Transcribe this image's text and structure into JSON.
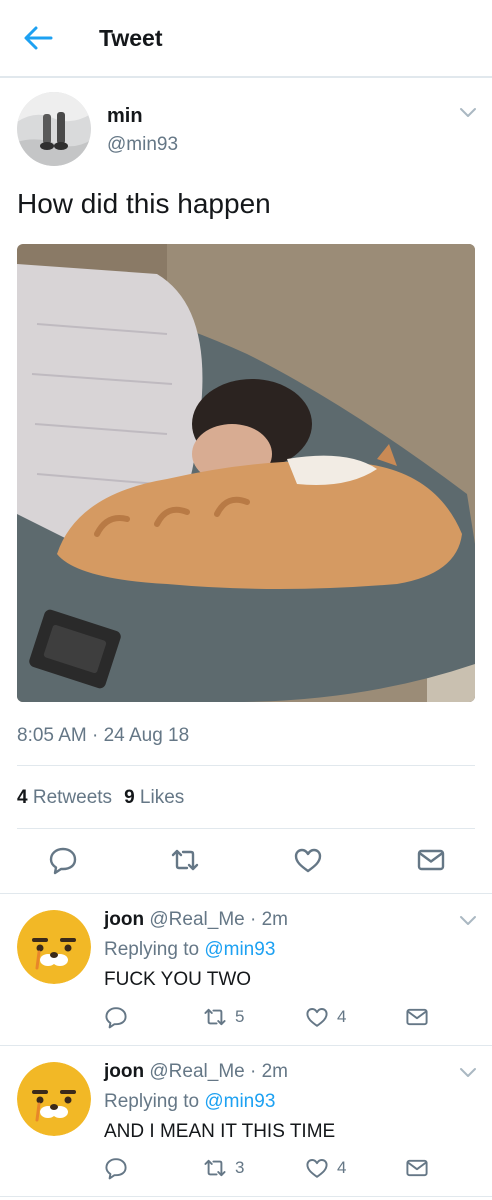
{
  "header": {
    "title": "Tweet"
  },
  "tweet": {
    "author_name": "min",
    "author_handle": "@min93",
    "text": "How did this happen",
    "timestamp": "8:05 AM · 24 Aug 18",
    "retweets_count": "4",
    "retweets_label": "Retweets",
    "likes_count": "9",
    "likes_label": "Likes"
  },
  "replies": [
    {
      "name": "joon",
      "handle": "@Real_Me",
      "time": "· 2m",
      "replying_prefix": "Replying to",
      "replying_handle": "@min93",
      "text": "FUCK YOU TWO",
      "retweets": "5",
      "likes": "4"
    },
    {
      "name": "joon",
      "handle": "@Real_Me",
      "time": "· 2m",
      "replying_prefix": "Replying to",
      "replying_handle": "@min93",
      "text": "AND I MEAN IT THIS TIME",
      "retweets": "3",
      "likes": "4"
    }
  ],
  "colors": {
    "accent": "#1da1f2",
    "secondary_text": "#657786",
    "divider": "#e1e8ed"
  }
}
